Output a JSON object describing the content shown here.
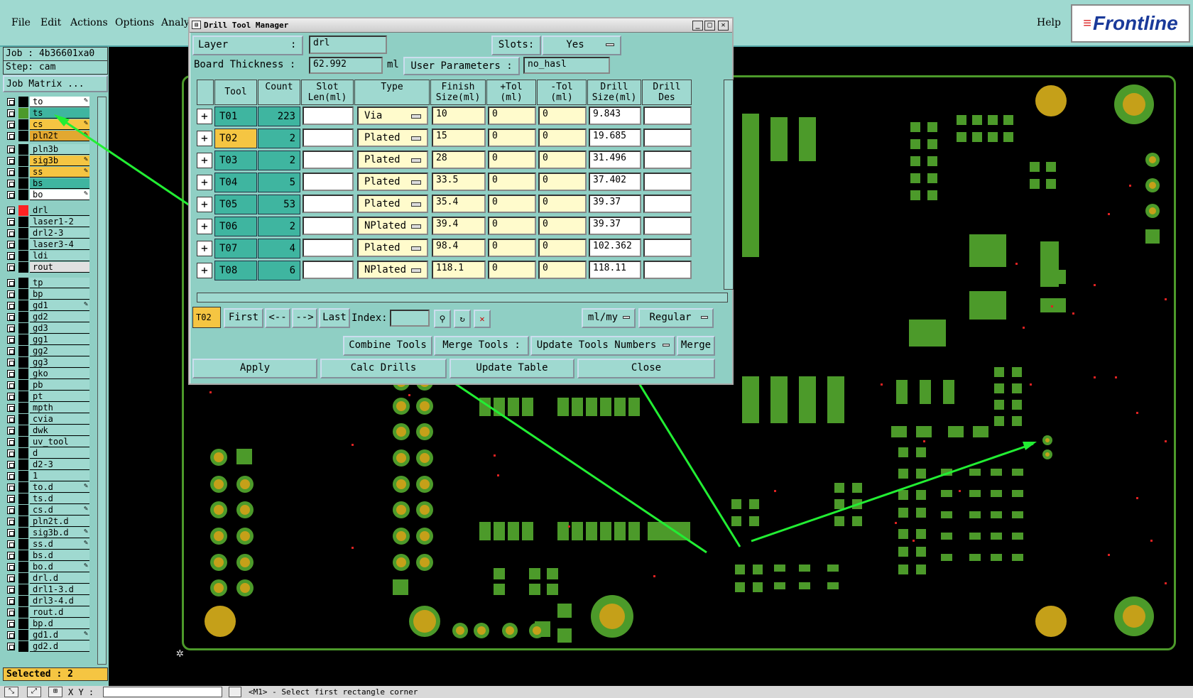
{
  "menu": {
    "file": "File",
    "edit": "Edit",
    "actions": "Actions",
    "options": "Options",
    "analysis": "Analy",
    "help": "Help",
    "logo": "Frontline"
  },
  "job": {
    "job_label": "Job : 4b36601xa0",
    "step_label": "Step: cam",
    "matrix_button": "Job Matrix ..."
  },
  "layers": [
    {
      "name": "to",
      "color": "#ffffff",
      "swatch": "#000000",
      "pen": true
    },
    {
      "name": "ts",
      "color": "#3fb5a0",
      "swatch": "#4c9a2a",
      "pen": false
    },
    {
      "name": "cs",
      "color": "#f5c542",
      "swatch": "#000000",
      "pen": true
    },
    {
      "name": "pln2t",
      "color": "#e2a830",
      "swatch": "#000000",
      "pen": true
    },
    {
      "name": "pln3b",
      "color": "#9fd9d0",
      "swatch": "#000000",
      "pen": false
    },
    {
      "name": "sig3b",
      "color": "#f5c542",
      "swatch": "#000000",
      "pen": true
    },
    {
      "name": "ss",
      "color": "#f5c542",
      "swatch": "#000000",
      "pen": true
    },
    {
      "name": "bs",
      "color": "#3fb5a0",
      "swatch": "#000000",
      "pen": false
    },
    {
      "name": "bo",
      "color": "#ffffff",
      "swatch": "#000000",
      "pen": true
    },
    {
      "name": "drl",
      "color": "#8fcfc4",
      "swatch": "#ff2222",
      "pen": false
    },
    {
      "name": "laser1-2",
      "color": "#9fd9d0",
      "swatch": "#000000",
      "pen": false
    },
    {
      "name": "drl2-3",
      "color": "#9fd9d0",
      "swatch": "#000000",
      "pen": false
    },
    {
      "name": "laser3-4",
      "color": "#9fd9d0",
      "swatch": "#000000",
      "pen": false
    },
    {
      "name": "ldi",
      "color": "#9fd9d0",
      "swatch": "#000000",
      "pen": false
    },
    {
      "name": "rout",
      "color": "#e0e0e0",
      "swatch": "#000000",
      "pen": false
    },
    {
      "name": "tp",
      "color": "#9fd9d0",
      "swatch": "#000000",
      "pen": false
    },
    {
      "name": "bp",
      "color": "#9fd9d0",
      "swatch": "#000000",
      "pen": false
    },
    {
      "name": "gd1",
      "color": "#9fd9d0",
      "swatch": "#000000",
      "pen": true
    },
    {
      "name": "gd2",
      "color": "#9fd9d0",
      "swatch": "#000000",
      "pen": false
    },
    {
      "name": "gd3",
      "color": "#9fd9d0",
      "swatch": "#000000",
      "pen": false
    },
    {
      "name": "gg1",
      "color": "#9fd9d0",
      "swatch": "#000000",
      "pen": false
    },
    {
      "name": "gg2",
      "color": "#9fd9d0",
      "swatch": "#000000",
      "pen": false
    },
    {
      "name": "gg3",
      "color": "#9fd9d0",
      "swatch": "#000000",
      "pen": false
    },
    {
      "name": "gko",
      "color": "#9fd9d0",
      "swatch": "#000000",
      "pen": false
    },
    {
      "name": "pb",
      "color": "#9fd9d0",
      "swatch": "#000000",
      "pen": false
    },
    {
      "name": "pt",
      "color": "#9fd9d0",
      "swatch": "#000000",
      "pen": false
    },
    {
      "name": "mpth",
      "color": "#9fd9d0",
      "swatch": "#000000",
      "pen": false
    },
    {
      "name": "cvia",
      "color": "#9fd9d0",
      "swatch": "#000000",
      "pen": false
    },
    {
      "name": "dwk",
      "color": "#9fd9d0",
      "swatch": "#000000",
      "pen": false
    },
    {
      "name": "uv_tool",
      "color": "#9fd9d0",
      "swatch": "#000000",
      "pen": false
    },
    {
      "name": "d",
      "color": "#9fd9d0",
      "swatch": "#000000",
      "pen": false
    },
    {
      "name": "d2-3",
      "color": "#9fd9d0",
      "swatch": "#000000",
      "pen": false
    },
    {
      "name": "1",
      "color": "#9fd9d0",
      "swatch": "#000000",
      "pen": false
    },
    {
      "name": "to.d",
      "color": "#9fd9d0",
      "swatch": "#000000",
      "pen": true
    },
    {
      "name": "ts.d",
      "color": "#9fd9d0",
      "swatch": "#000000",
      "pen": false
    },
    {
      "name": "cs.d",
      "color": "#9fd9d0",
      "swatch": "#000000",
      "pen": true
    },
    {
      "name": "pln2t.d",
      "color": "#9fd9d0",
      "swatch": "#000000",
      "pen": false
    },
    {
      "name": "sig3b.d",
      "color": "#9fd9d0",
      "swatch": "#000000",
      "pen": true
    },
    {
      "name": "ss.d",
      "color": "#9fd9d0",
      "swatch": "#000000",
      "pen": true
    },
    {
      "name": "bs.d",
      "color": "#9fd9d0",
      "swatch": "#000000",
      "pen": false
    },
    {
      "name": "bo.d",
      "color": "#9fd9d0",
      "swatch": "#000000",
      "pen": true
    },
    {
      "name": "drl.d",
      "color": "#9fd9d0",
      "swatch": "#000000",
      "pen": false
    },
    {
      "name": "drl1-3.d",
      "color": "#9fd9d0",
      "swatch": "#000000",
      "pen": false
    },
    {
      "name": "drl3-4.d",
      "color": "#9fd9d0",
      "swatch": "#000000",
      "pen": false
    },
    {
      "name": "rout.d",
      "color": "#9fd9d0",
      "swatch": "#000000",
      "pen": false
    },
    {
      "name": "bp.d",
      "color": "#9fd9d0",
      "swatch": "#000000",
      "pen": false
    },
    {
      "name": "gd1.d",
      "color": "#9fd9d0",
      "swatch": "#000000",
      "pen": true
    },
    {
      "name": "gd2.d",
      "color": "#9fd9d0",
      "swatch": "#000000",
      "pen": false
    }
  ],
  "selected_label": "Selected : 2",
  "status": {
    "xy_label": "X Y :",
    "message": "<M1> - Select first rectangle corner"
  },
  "dialog": {
    "title": "Drill Tool Manager",
    "layer_label": "Layer",
    "layer_colon": ":",
    "layer_value": "drl",
    "slots_label": "Slots:",
    "slots_value": "Yes",
    "thickness_label": "Board Thickness :",
    "thickness_value": "62.992",
    "thickness_unit": "ml",
    "user_params_label": "User Parameters :",
    "user_params_value": "no_hasl",
    "headers": [
      "Tool",
      "Count",
      "Slot\nLen(ml)",
      "Type",
      "Finish\nSize(ml)",
      "+Tol\n(ml)",
      "-Tol\n(ml)",
      "Drill\nSize(ml)",
      "Drill\nDes"
    ],
    "rows": [
      {
        "tool": "T01",
        "count": "223",
        "slot": "",
        "type": "Via",
        "finish": "10",
        "ptol": "0",
        "ntol": "0",
        "drill": "9.843",
        "des": "",
        "selected": false
      },
      {
        "tool": "T02",
        "count": "2",
        "slot": "",
        "type": "Plated",
        "finish": "15",
        "ptol": "0",
        "ntol": "0",
        "drill": "19.685",
        "des": "",
        "selected": true
      },
      {
        "tool": "T03",
        "count": "2",
        "slot": "",
        "type": "Plated",
        "finish": "28",
        "ptol": "0",
        "ntol": "0",
        "drill": "31.496",
        "des": "",
        "selected": false
      },
      {
        "tool": "T04",
        "count": "5",
        "slot": "",
        "type": "Plated",
        "finish": "33.5",
        "ptol": "0",
        "ntol": "0",
        "drill": "37.402",
        "des": "",
        "selected": false
      },
      {
        "tool": "T05",
        "count": "53",
        "slot": "",
        "type": "Plated",
        "finish": "35.4",
        "ptol": "0",
        "ntol": "0",
        "drill": "39.37",
        "des": "",
        "selected": false
      },
      {
        "tool": "T06",
        "count": "2",
        "slot": "",
        "type": "NPlated",
        "finish": "39.4",
        "ptol": "0",
        "ntol": "0",
        "drill": "39.37",
        "des": "",
        "selected": false
      },
      {
        "tool": "T07",
        "count": "4",
        "slot": "",
        "type": "Plated",
        "finish": "98.4",
        "ptol": "0",
        "ntol": "0",
        "drill": "102.362",
        "des": "",
        "selected": false
      },
      {
        "tool": "T08",
        "count": "6",
        "slot": "",
        "type": "NPlated",
        "finish": "118.1",
        "ptol": "0",
        "ntol": "0",
        "drill": "118.11",
        "des": "",
        "selected": false
      }
    ],
    "nav": {
      "current": "T02",
      "first": "First",
      "prev": "<--",
      "next": "-->",
      "last": "Last",
      "index_label": "Index:",
      "units": "ml/my",
      "mode": "Regular"
    },
    "actions": {
      "combine": "Combine Tools",
      "merge_label": "Merge Tools :",
      "update_numbers": "Update Tools Numbers",
      "merge": "Merge"
    },
    "footer": {
      "apply": "Apply",
      "calc": "Calc Drills",
      "update": "Update Table",
      "close": "Close"
    }
  }
}
